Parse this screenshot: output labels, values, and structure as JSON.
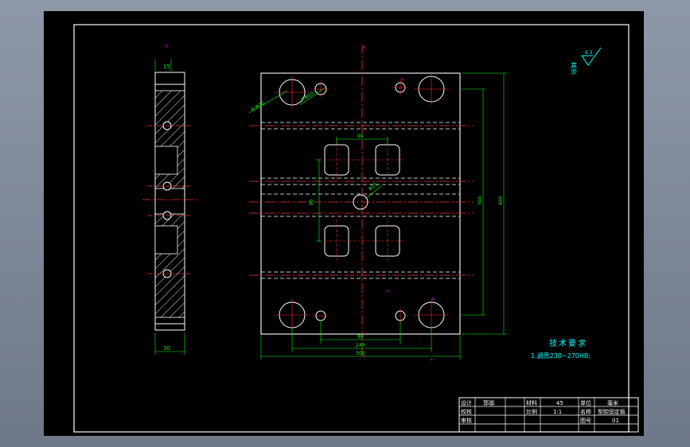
{
  "drawing": {
    "tech_requirements": {
      "title": "技术要求",
      "item1": "1.调质230~270HB;"
    },
    "roughness": {
      "value": "6.3",
      "label": "其余"
    },
    "dimensions": {
      "side_top": "15",
      "side_bottom": "30",
      "hole_large": "4-Φ30",
      "hole_small": "2-Φ10",
      "center_hole": "Φ25",
      "top_width": "90",
      "left_height": "90",
      "right_inner": "300",
      "right_outer": "400",
      "bottom_inner": "80",
      "bottom_mid": "240",
      "bottom_outer": "300"
    },
    "title_block": {
      "design_label": "设计",
      "designer": "郭珈",
      "check_label": "校核",
      "review_label": "审核",
      "material_label": "材料",
      "material": "45",
      "scale_label": "比例",
      "scale": "1:1",
      "unit_label": "单位",
      "unit": "毫米",
      "name_label": "名称",
      "part_name": "型腔固定板",
      "drawing_no_label": "图号",
      "drawing_no": "01"
    },
    "colors": {
      "border": "#ffffff",
      "geometry": "#ffffff",
      "centerline": "#ff3030",
      "dimension": "#00ff00",
      "text_cyan": "#00ffff",
      "marker": "#ff00ff",
      "hatch": "#ffffff"
    }
  }
}
